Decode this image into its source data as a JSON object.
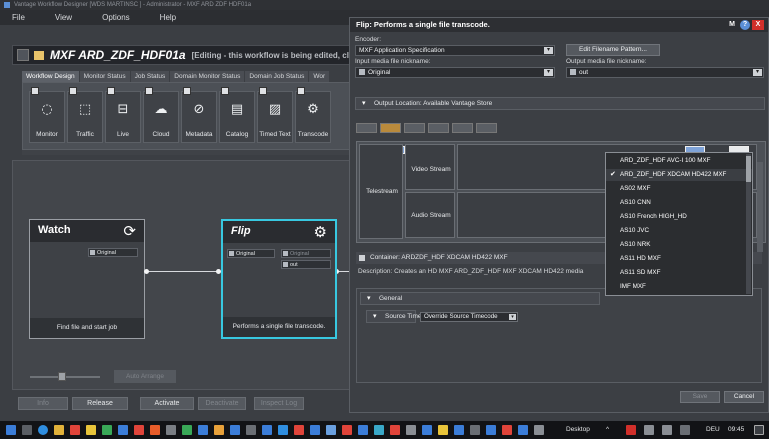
{
  "window": {
    "title": "Vantage Workflow Designer [WDS MARTINSC ] - Administrator - MXF ARD ZDF HDF01a"
  },
  "menu": [
    "File",
    "View",
    "Options",
    "Help"
  ],
  "workflow": {
    "title": "MXF ARD_ZDF_HDF01a",
    "subtitle": "[Editing - this workflow is being edited, clic"
  },
  "tabs": [
    "Workflow Design",
    "Monitor Status",
    "Job Status",
    "Domain Monitor Status",
    "Domain Job Status",
    "Wor"
  ],
  "toolbox": [
    {
      "label": "Monitor",
      "glyph": "◌",
      "icon": "monitor-icon"
    },
    {
      "label": "Traffic",
      "glyph": "⬚",
      "icon": "traffic-icon"
    },
    {
      "label": "Live",
      "glyph": "⊟",
      "icon": "live-icon"
    },
    {
      "label": "Cloud",
      "glyph": "☁",
      "icon": "cloud-icon"
    },
    {
      "label": "Metadata",
      "glyph": "⊘",
      "icon": "metadata-icon"
    },
    {
      "label": "Catalog",
      "glyph": "▤",
      "icon": "catalog-icon"
    },
    {
      "label": "Timed Text",
      "glyph": "▨",
      "icon": "timed-text-icon"
    },
    {
      "label": "Transcode",
      "glyph": "⚙",
      "icon": "transcode-icon"
    }
  ],
  "nodes": {
    "watch": {
      "name": "Watch",
      "pin": "Original",
      "footer": "Find file and start job"
    },
    "flip": {
      "name": "Flip",
      "pin_in": "Original",
      "pin_out_1": "Original",
      "pin_out_2": "out",
      "footer": "Performs a single file transcode."
    }
  },
  "canvas": {
    "auto_arrange": "Auto Arrange",
    "zoom_level": 0.45
  },
  "bottom_buttons": [
    "Info",
    "Release",
    "Activate",
    "Deactivate",
    "Inspect Log"
  ],
  "dialog": {
    "title": "Flip: Performs a single file transcode.",
    "controls": {
      "menu": "M",
      "help": "?",
      "close": "X"
    },
    "encoder_label": "Encoder:",
    "encoder_value": "MXF Application Specification",
    "edit_filename": "Edit Filename Pattern...",
    "input_label": "Input media file nickname:",
    "input_value": "Original",
    "output_label": "Output media file nickname:",
    "output_value": "out",
    "output_location": "Output Location: Available Vantage Store",
    "telestream": "Telestream",
    "video_stream": "Video Stream",
    "audio_stream": "Audio Stream",
    "container": "Container: ARDZDF_HDF XDCAM HD422 MXF",
    "description": "Description: Creates an HD MXF ARD_ZDF_HDF MXF XDCAM HD422 media",
    "general": "General",
    "source_timecode_label": "Source Timecode",
    "source_timecode_value": "Override Source Timecode",
    "save": "Save",
    "cancel": "Cancel"
  },
  "dropdown": {
    "items": [
      "ARD_ZDF_HDF AVC-I 100 MXF",
      "ARD_ZDF_HDF XDCAM HD422 MXF",
      "AS02 MXF",
      "AS10 CNN",
      "AS10 French HIGH_HD",
      "AS10 JVC",
      "AS10 NRK",
      "AS11 HD MXF",
      "AS11 SD MXF",
      "IMF MXF"
    ],
    "selected_index": 1
  },
  "taskbar": {
    "desktop": "Desktop",
    "language": "DEU",
    "time": "09:45"
  },
  "colors": {
    "accent": "#38c8e0",
    "close": "#d12f2a"
  }
}
